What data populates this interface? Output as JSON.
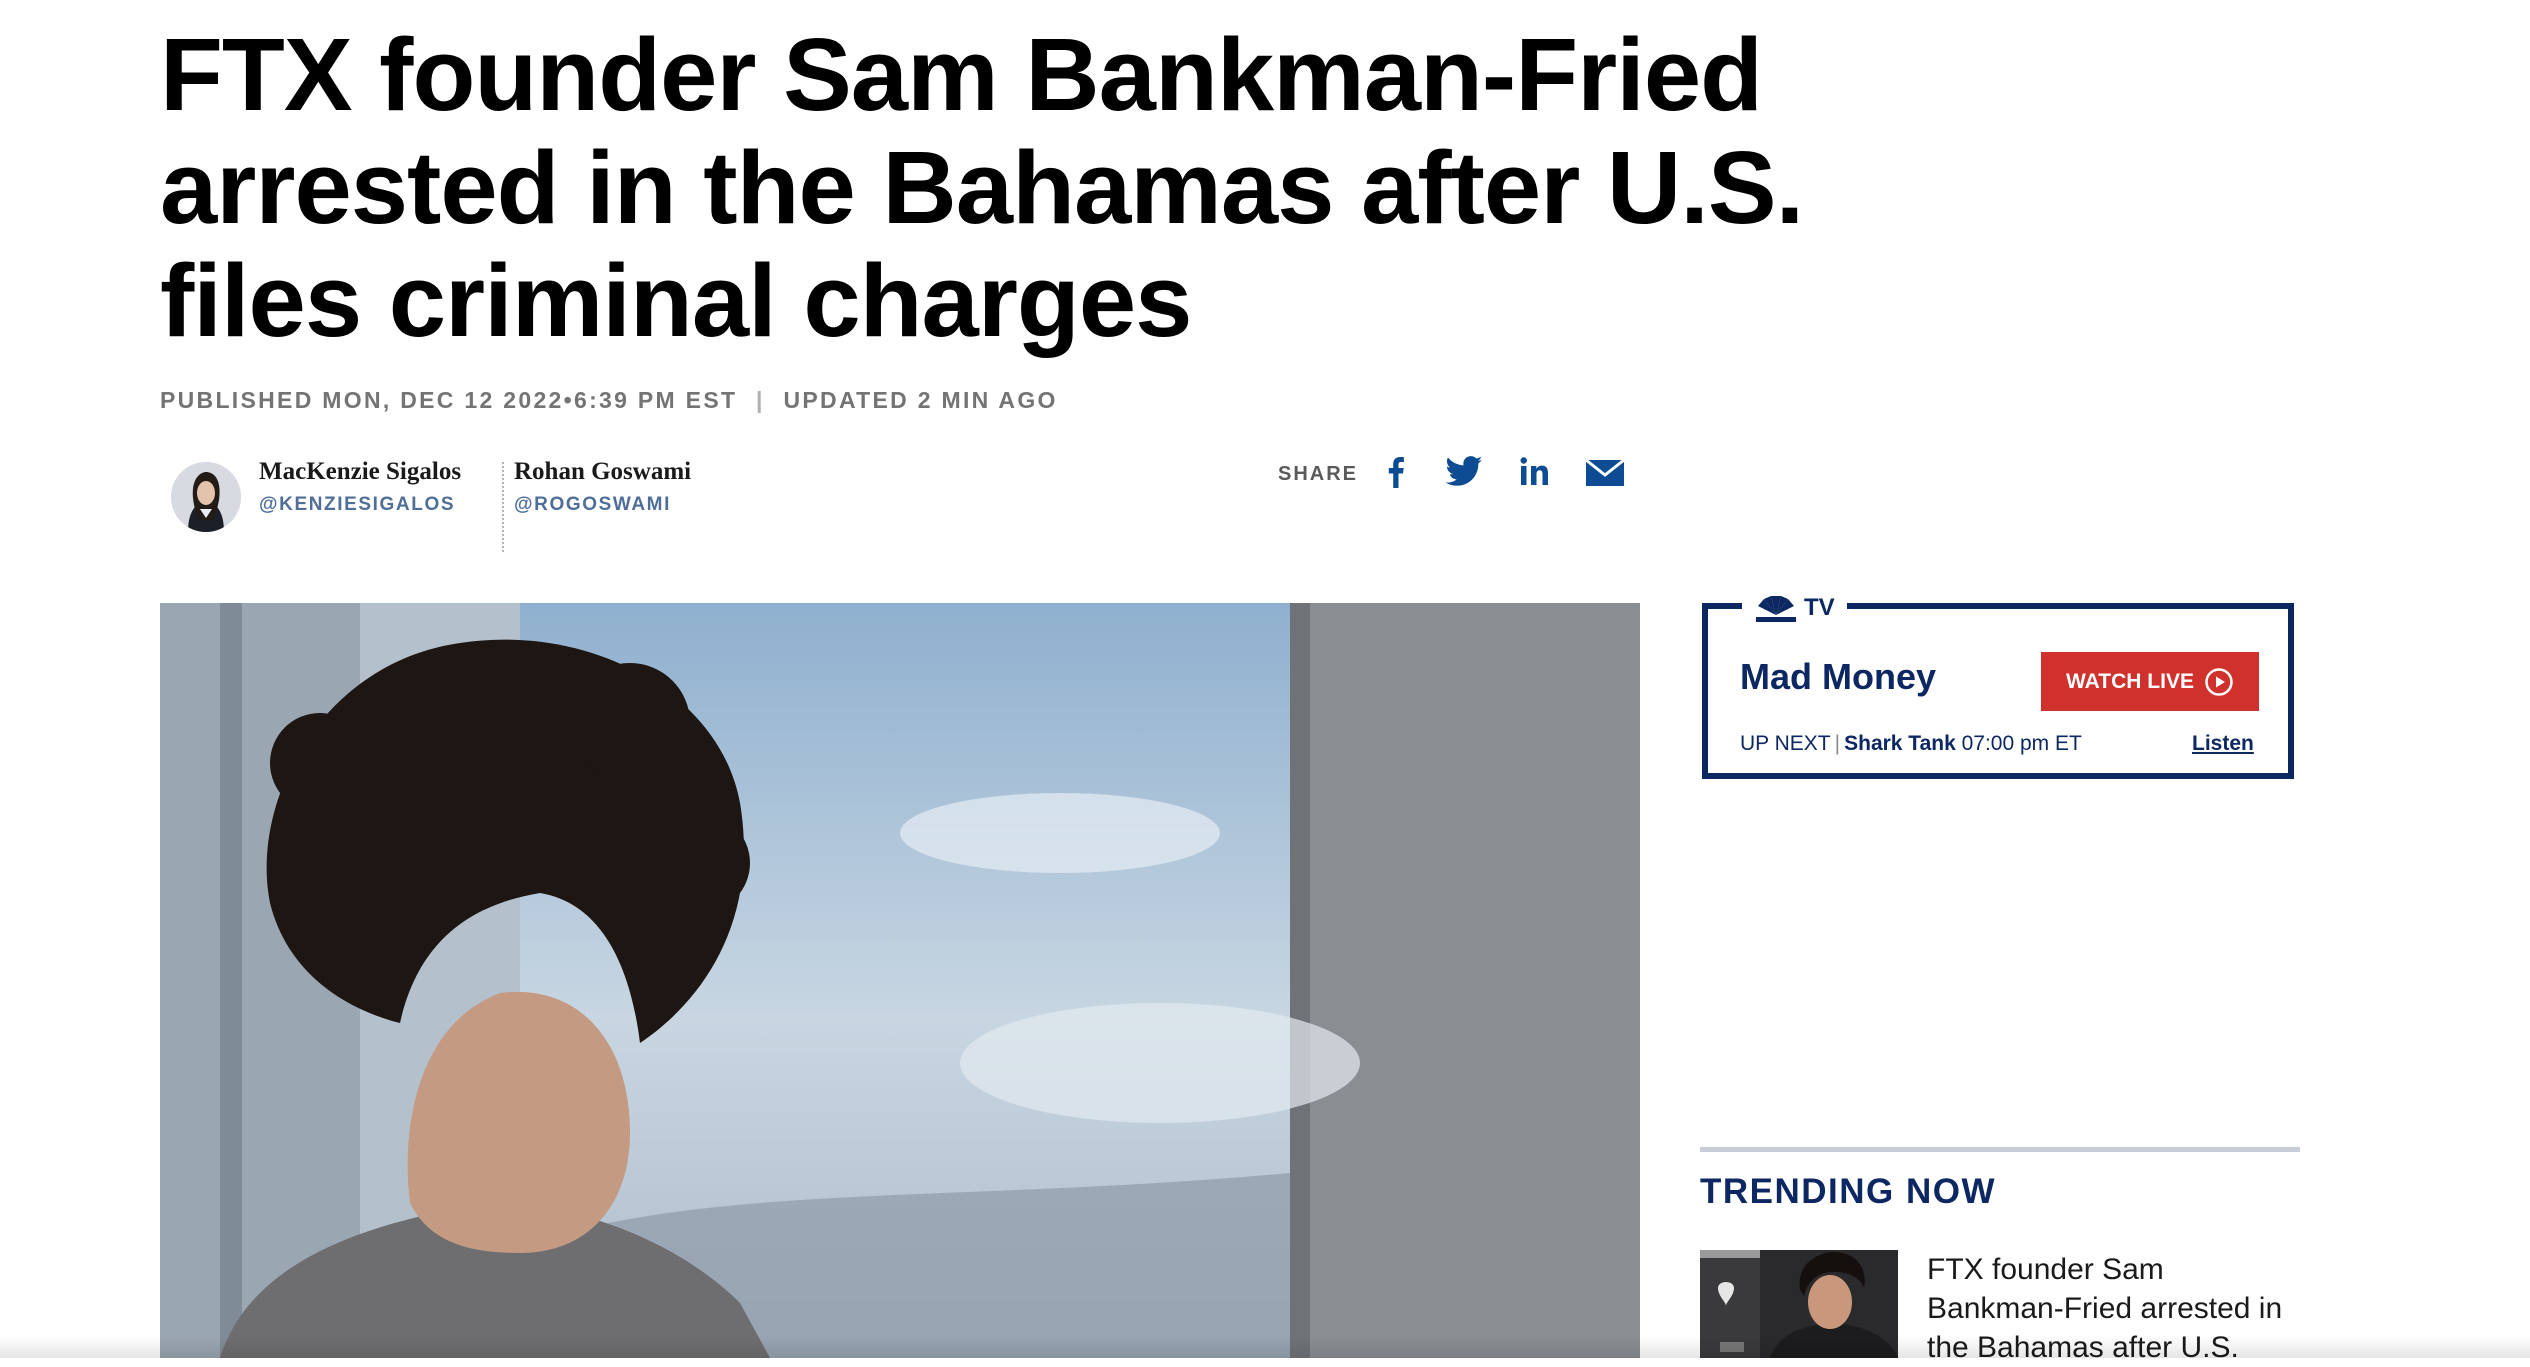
{
  "article": {
    "headline": "FTX founder Sam Bankman-Fried arrested in the Bahamas after U.S. files criminal charges",
    "published": "PUBLISHED MON, DEC 12 2022•6:39 PM EST",
    "updated": "UPDATED 2 MIN AGO"
  },
  "authors": [
    {
      "name": "MacKenzie Sigalos",
      "handle": "@KENZIESIGALOS"
    },
    {
      "name": "Rohan Goswami",
      "handle": "@ROGOSWAMI"
    }
  ],
  "share": {
    "label": "SHARE",
    "icons": [
      "facebook-icon",
      "twitter-icon",
      "linkedin-icon",
      "email-icon"
    ],
    "icon_color": "#0d4c92"
  },
  "tv_widget": {
    "brand": "TV",
    "show_title": "Mad Money",
    "watch_button": "WATCH LIVE",
    "up_next_label": "UP NEXT",
    "up_next_show": "Shark Tank",
    "up_next_time": "07:00 pm ET",
    "listen_label": "Listen"
  },
  "trending": {
    "title": "TRENDING NOW",
    "items": [
      {
        "text": "FTX founder Sam Bankman-Fried arrested in the Bahamas after U.S."
      }
    ]
  },
  "colors": {
    "navy": "#0d2762",
    "accent_red": "#d0312d",
    "handle_blue": "#4f6f99"
  }
}
